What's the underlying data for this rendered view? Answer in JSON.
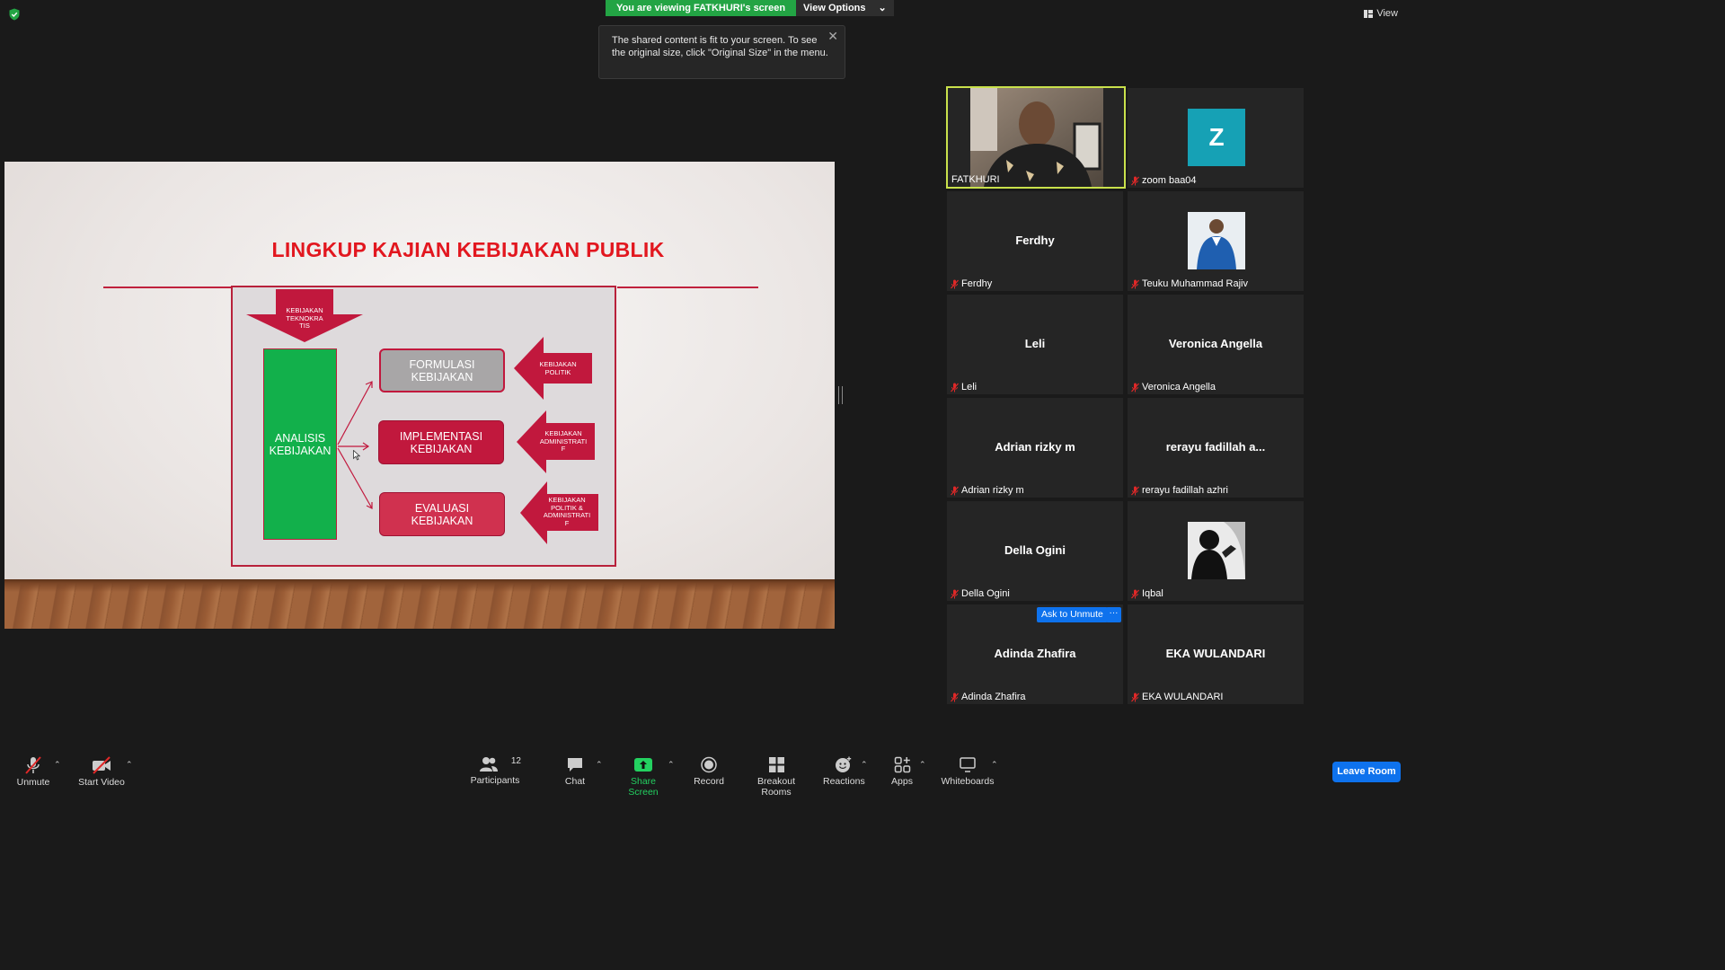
{
  "top": {
    "banner_text": "You are viewing FATKHURI's screen",
    "view_options": "View Options",
    "tooltip": "The shared content is fit to your screen. To see the original size, click \"Original Size\" in the menu.",
    "view_label": "View"
  },
  "slide": {
    "title": "LINGKUP KAJIAN KEBIJAKAN PUBLIK",
    "top_arrow": [
      "KEBIJAKAN",
      "TEKNOKRA",
      "TIS"
    ],
    "analisis": [
      "ANALISIS",
      "KEBIJAKAN"
    ],
    "formulasi": [
      "FORMULASI",
      "KEBIJAKAN"
    ],
    "implementasi": [
      "IMPLEMENTASI",
      "KEBIJAKAN"
    ],
    "evaluasi": [
      "EVALUASI",
      "KEBIJAKAN"
    ],
    "arrow_politik": [
      "KEBIJAKAN",
      "POLITIK"
    ],
    "arrow_administratif": [
      "KEBIJAKAN",
      "ADMINISTRATI",
      "F"
    ],
    "arrow_politik_admin": [
      "KEBIJAKAN",
      "POLITIK &",
      "ADMINISTRATI",
      "F"
    ],
    "colors": {
      "title": "#e2171f",
      "green": "#12b04b",
      "crimson": "#c1183d",
      "gray": "#a8a6a7"
    }
  },
  "gallery": [
    {
      "name": "FATKHURI",
      "center": "",
      "kind": "video",
      "muted": false
    },
    {
      "name": "zoom baa04",
      "center": "",
      "kind": "avatar",
      "avatar_letter": "Z",
      "avatar_color": "#16a1b5",
      "muted": true
    },
    {
      "name": "Ferdhy",
      "center": "Ferdhy",
      "kind": "name",
      "muted": true
    },
    {
      "name": "Teuku Muhammad Rajiv",
      "center": "",
      "kind": "photo",
      "muted": true
    },
    {
      "name": "Leli",
      "center": "Leli",
      "kind": "name",
      "muted": true
    },
    {
      "name": "Veronica Angella",
      "center": "Veronica Angella",
      "kind": "name",
      "muted": true
    },
    {
      "name": "Adrian rizky m",
      "center": "Adrian rizky m",
      "kind": "name",
      "muted": true
    },
    {
      "name": "rerayu fadillah azhri",
      "center": "rerayu fadillah a...",
      "kind": "name",
      "muted": true
    },
    {
      "name": "Della Ogini",
      "center": "Della Ogini",
      "kind": "name",
      "muted": true
    },
    {
      "name": "Iqbal",
      "center": "",
      "kind": "photo-bw",
      "muted": true
    },
    {
      "name": "Adinda Zhafira",
      "center": "Adinda Zhafira",
      "kind": "name",
      "muted": true
    },
    {
      "name": "EKA WULANDARI",
      "center": "EKA WULANDARI",
      "kind": "name",
      "muted": true
    }
  ],
  "hover_actions": {
    "ask_unmute": "Ask to Unmute",
    "more": "···"
  },
  "toolbar": {
    "unmute": "Unmute",
    "start_video": "Start Video",
    "participants": "Participants",
    "participants_count": "12",
    "chat": "Chat",
    "share_screen": "Share Screen",
    "record": "Record",
    "breakout_rooms": "Breakout Rooms",
    "reactions": "Reactions",
    "apps": "Apps",
    "whiteboards": "Whiteboards",
    "leave": "Leave Room"
  }
}
